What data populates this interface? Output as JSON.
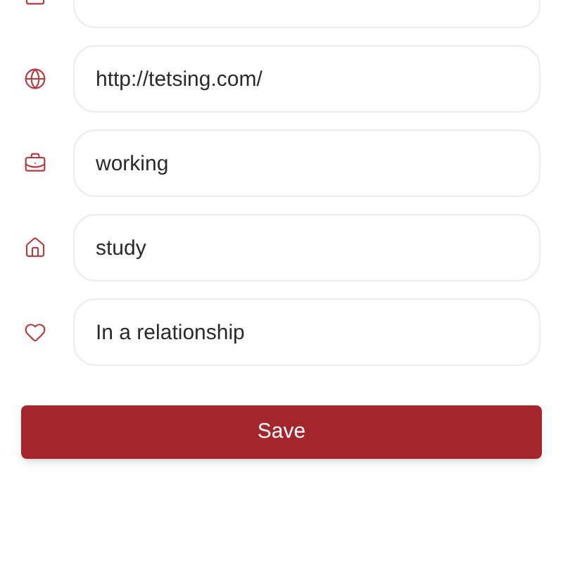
{
  "fields": [
    {
      "kind": "lock"
    },
    {
      "kind": "globe",
      "value": "http://tetsing.com/"
    },
    {
      "kind": "briefcase",
      "value": "working"
    },
    {
      "kind": "home",
      "value": "study"
    },
    {
      "kind": "heart",
      "value": "In a relationship"
    }
  ],
  "save_button": "Save"
}
